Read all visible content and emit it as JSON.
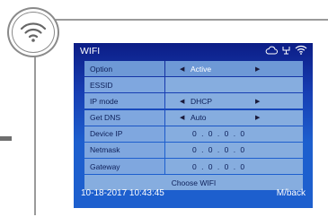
{
  "screen": {
    "title": "WIFI",
    "rows": [
      {
        "label": "Option",
        "value": "Active",
        "has_arrows": true
      },
      {
        "label": "ESSID",
        "value": "",
        "has_arrows": false
      },
      {
        "label": "IP mode",
        "value": "DHCP",
        "has_arrows": true
      },
      {
        "label": "Get DNS",
        "value": "Auto",
        "has_arrows": true
      },
      {
        "label": "Device IP",
        "value": "0 . 0 . 0 . 0",
        "has_arrows": false
      },
      {
        "label": "Netmask",
        "value": "0 . 0 . 0 . 0",
        "has_arrows": false
      },
      {
        "label": "Gateway",
        "value": "0 . 0 . 0 . 0",
        "has_arrows": false
      }
    ],
    "choose_wifi_label": "Choose WIFI",
    "datetime": "10-18-2017 10:43:45",
    "back_label": "M/back",
    "status_icons": [
      "cloud-icon",
      "usb-icon",
      "wifi-icon"
    ]
  },
  "callout_icon": "wifi-icon",
  "colors": {
    "screen_top": "#0c1d86",
    "screen_bottom": "#1d5fce",
    "cell": "#86addf",
    "cell_text": "#0d1f58"
  }
}
